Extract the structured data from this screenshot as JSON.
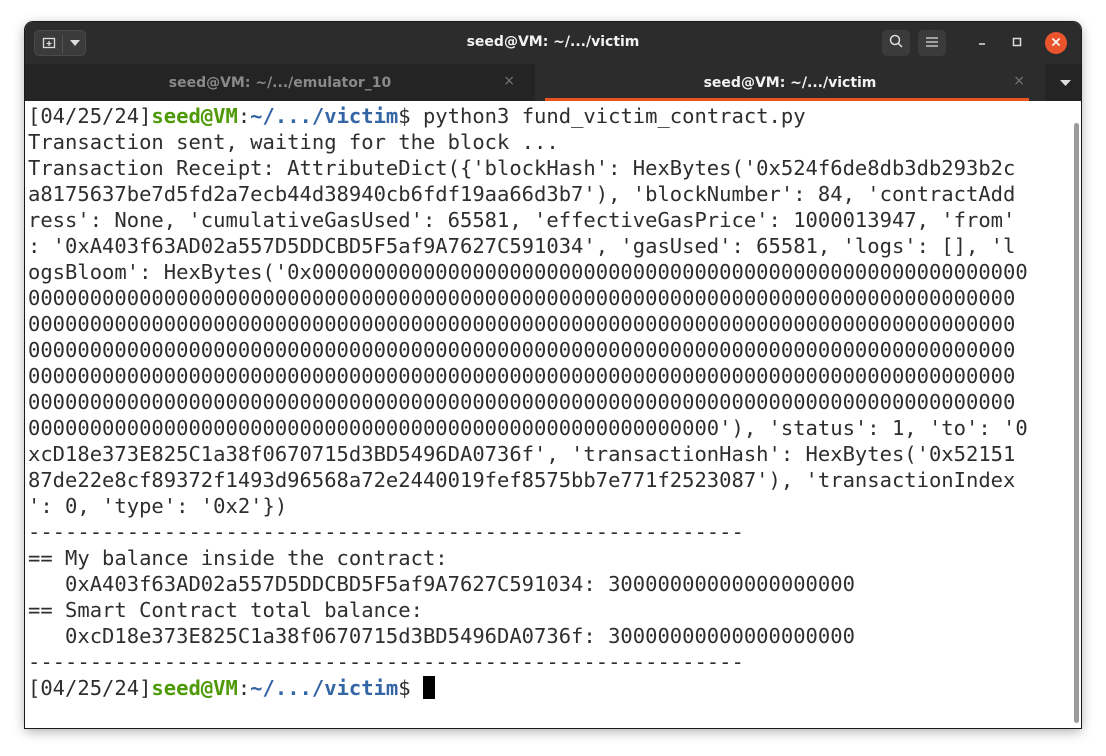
{
  "window": {
    "title": "seed@VM: ~/.../victim"
  },
  "tabs": [
    {
      "label": "seed@VM: ~/.../emulator_10",
      "close": "×"
    },
    {
      "label": "seed@VM: ~/.../victim",
      "close": "×"
    }
  ],
  "icons": {
    "new_tab": "new-tab-icon",
    "dropdown": "chevron-down-icon",
    "search": "search-icon",
    "menu": "hamburger-menu-icon",
    "minimize": "minimize-icon",
    "maximize": "maximize-icon",
    "close": "close-icon"
  },
  "colors": {
    "accent": "#e95420",
    "user": "#4e9a06",
    "path": "#3465a4"
  },
  "terminal": {
    "prompt1": {
      "time": "[04/25/24]",
      "user": "seed@VM",
      "colon": ":",
      "path": "~/.../victim",
      "dollar": "$ ",
      "command": "python3 fund_victim_contract.py"
    },
    "lines": [
      "Transaction sent, waiting for the block ...",
      "Transaction Receipt: AttributeDict({'blockHash': HexBytes('0x524f6de8db3db293b2c",
      "a8175637be7d5fd2a7ecb44d38940cb6fdf19aa66d3b7'), 'blockNumber': 84, 'contractAdd",
      "ress': None, 'cumulativeGasUsed': 65581, 'effectiveGasPrice': 1000013947, 'from'",
      ": '0xA403f63AD02a557D5DDCBD5F5af9A7627C591034', 'gasUsed': 65581, 'logs': [], 'l",
      "ogsBloom': HexBytes('0x0000000000000000000000000000000000000000000000000000000000",
      "00000000000000000000000000000000000000000000000000000000000000000000000000000000",
      "00000000000000000000000000000000000000000000000000000000000000000000000000000000",
      "00000000000000000000000000000000000000000000000000000000000000000000000000000000",
      "00000000000000000000000000000000000000000000000000000000000000000000000000000000",
      "00000000000000000000000000000000000000000000000000000000000000000000000000000000",
      "00000000000000000000000000000000000000000000000000000000'), 'status': 1, 'to': '0",
      "xcD18e373E825C1a38f0670715d3BD5496DA0736f', 'transactionHash': HexBytes('0x52151",
      "87de22e8cf89372f1493d96568a72e2440019fef8575bb7e771f2523087'), 'transactionIndex",
      "': 0, 'type': '0x2'})",
      "----------------------------------------------------------",
      "== My balance inside the contract:",
      "   0xA403f63AD02a557D5DDCBD5F5af9A7627C591034: 30000000000000000000",
      "== Smart Contract total balance:",
      "   0xcD18e373E825C1a38f0670715d3BD5496DA0736f: 30000000000000000000",
      "----------------------------------------------------------"
    ],
    "prompt2": {
      "time": "[04/25/24]",
      "user": "seed@VM",
      "colon": ":",
      "path": "~/.../victim",
      "dollar": "$ "
    }
  }
}
